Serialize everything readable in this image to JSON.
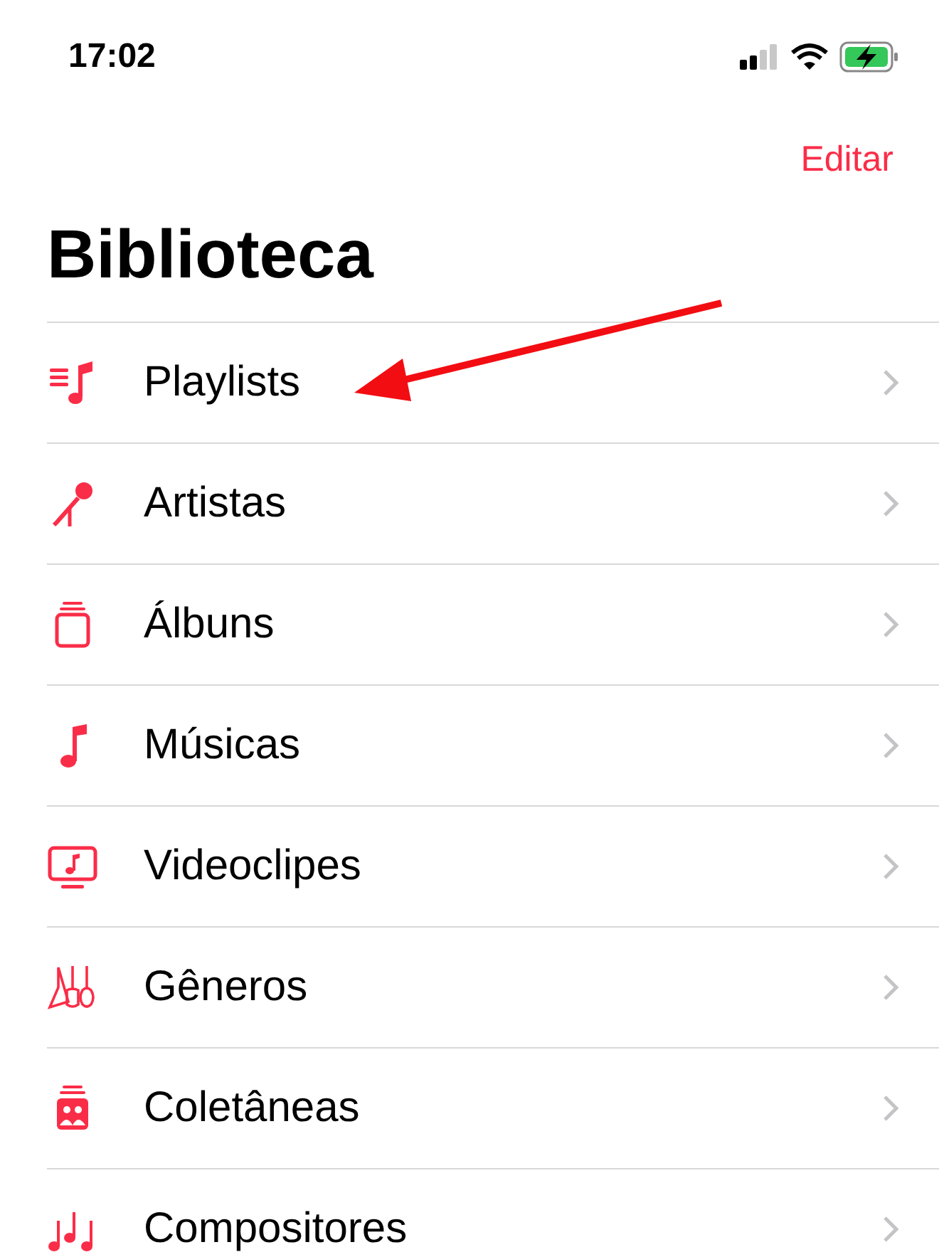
{
  "status_bar": {
    "time": "17:02"
  },
  "nav": {
    "edit": "Editar"
  },
  "title": "Biblioteca",
  "items": [
    {
      "label": "Playlists"
    },
    {
      "label": "Artistas"
    },
    {
      "label": "Álbuns"
    },
    {
      "label": "Músicas"
    },
    {
      "label": "Videoclipes"
    },
    {
      "label": "Gêneros"
    },
    {
      "label": "Coletâneas"
    },
    {
      "label": "Compositores"
    }
  ]
}
